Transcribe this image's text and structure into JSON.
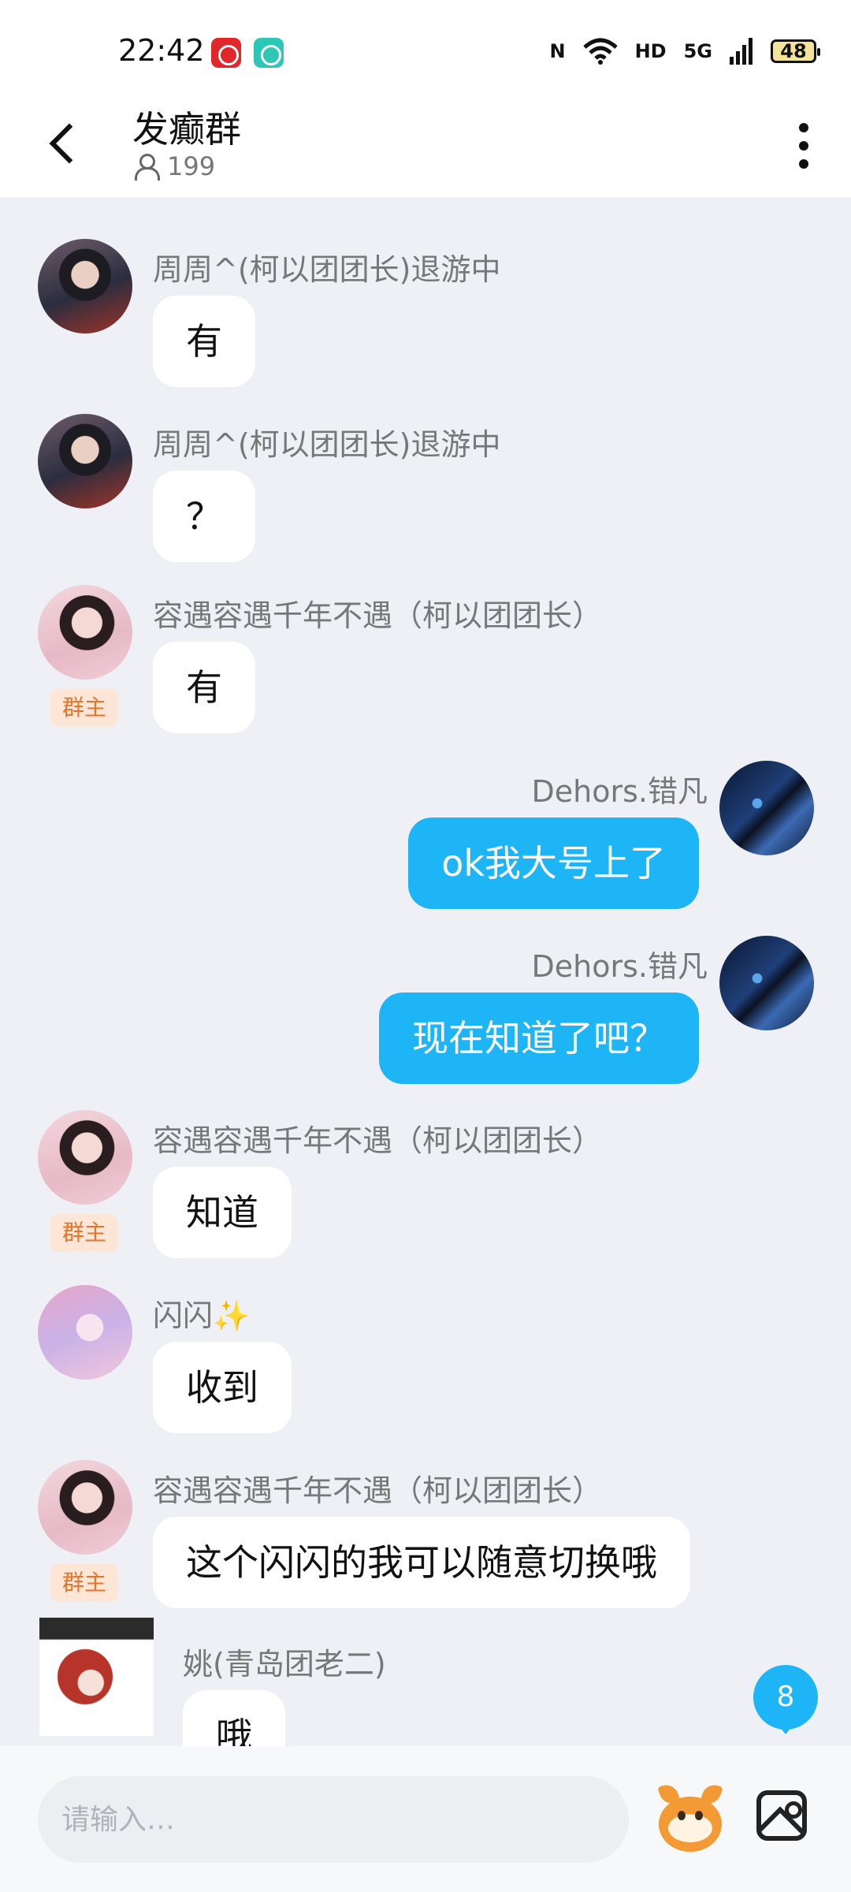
{
  "status_bar": {
    "time": "22:42",
    "nfc": "N",
    "wifi": "wifi-icon",
    "hd": "HD",
    "signal": "5G",
    "battery": "48"
  },
  "header": {
    "title": "发癫群",
    "member_count": "199"
  },
  "messages": [
    {
      "side": "left",
      "sender": "周周^(柯以团团长)退游中",
      "text": "有",
      "badge": ""
    },
    {
      "side": "left",
      "sender": "周周^(柯以团团长)退游中",
      "text": "？",
      "badge": ""
    },
    {
      "side": "left",
      "sender": "容遇容遇千年不遇（柯以团团长）",
      "text": "有",
      "badge": "群主"
    },
    {
      "side": "right",
      "sender": "Dehors.错凡",
      "text": "ok我大号上了",
      "badge": ""
    },
    {
      "side": "right",
      "sender": "Dehors.错凡",
      "text": "现在知道了吧？",
      "badge": ""
    },
    {
      "side": "left",
      "sender": "容遇容遇千年不遇（柯以团团长）",
      "text": "知道",
      "badge": "群主"
    },
    {
      "side": "left",
      "sender": "闪闪✨",
      "text": "收到",
      "badge": ""
    },
    {
      "side": "left",
      "sender": "容遇容遇千年不遇（柯以团团长）",
      "text": "这个闪闪的我可以随意切换哦",
      "badge": "群主"
    },
    {
      "side": "left",
      "sender": "姚(青岛团老二)",
      "text": "哦",
      "badge": ""
    }
  ],
  "new_message_count": "8",
  "input": {
    "placeholder": "请输入…"
  },
  "colors": {
    "accent": "#1eb5f7",
    "background": "#eef0f6",
    "owner_badge_bg": "#fde6d6",
    "owner_badge_text": "#e8742a"
  }
}
